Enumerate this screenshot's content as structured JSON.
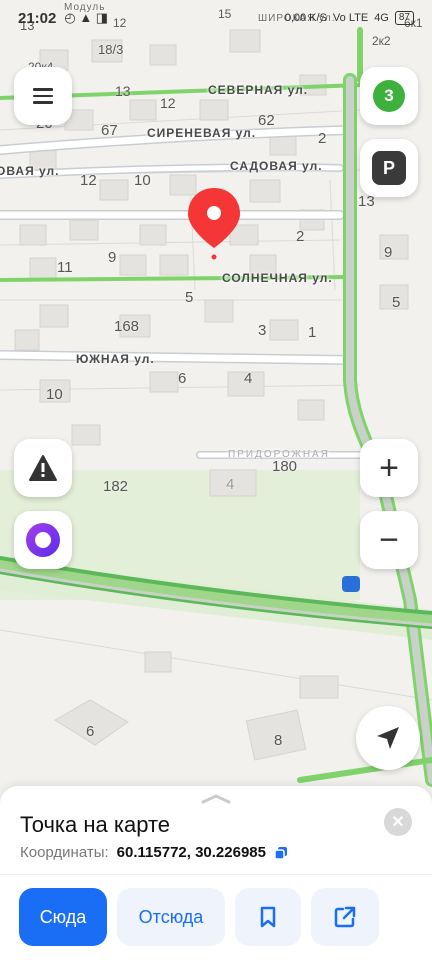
{
  "status_bar": {
    "time": "21:02",
    "left_icons": "◴ ▲ ◨",
    "network": "0,00 K/S",
    "lte": "Vo LTE",
    "signal": "4G",
    "battery": "87"
  },
  "map": {
    "streets": {
      "severnaya": "СЕВЕРНАЯ ул.",
      "sirenevaya": "СИРЕНЕВАЯ ул.",
      "sadovaya_left": "ОВАЯ ул.",
      "sadovaya": "САДОВАЯ ул.",
      "solnechnaya": "СОЛНЕЧНАЯ ул.",
      "yuzhnaya": "ЮЖНАЯ ул.",
      "pridorozhnaya": "ПРИДОРОЖНАЯ",
      "shirokaya": "ШИРОКАЯ ул.",
      "modul": "Модуль"
    },
    "house_numbers": {
      "n13a": "13",
      "n12a": "12",
      "n15": "15",
      "n18_3": "18/3",
      "n20k4": "20к4",
      "n13b": "13",
      "n12b": "12",
      "n62": "62",
      "n20": "20",
      "n67": "67",
      "n2a": "2",
      "n12c": "12",
      "n10a": "10",
      "n13c": "13",
      "n2b": "2",
      "n9a": "9",
      "n9b": "9",
      "n11": "11",
      "n5a": "5",
      "n5b": "5",
      "n168": "168",
      "n3": "3",
      "n1": "1",
      "n6a": "6",
      "n4a": "4",
      "n10b": "10",
      "n180": "180",
      "n182": "182",
      "n4b": "4",
      "n6b": "6",
      "n8": "8",
      "n6k1": "6к1",
      "n2k2": "2к2"
    },
    "pin_color": "#f43636",
    "road_green": "#7fd36a"
  },
  "controls": {
    "menu_icon": "hamburger-icon",
    "traffic_level": "3",
    "parking_label": "P",
    "zoom_in": "+",
    "zoom_out": "−",
    "close_label": "✕"
  },
  "sheet": {
    "title": "Точка на карте",
    "coords_label": "Координаты:",
    "coords_value": "60.115772, 30.226985",
    "buttons": {
      "here": "Сюда",
      "from": "Отсюда"
    }
  },
  "colors": {
    "accent": "#1a6ef5",
    "secondary_bg": "#eef3fc",
    "traffic_green": "#3db03d"
  }
}
